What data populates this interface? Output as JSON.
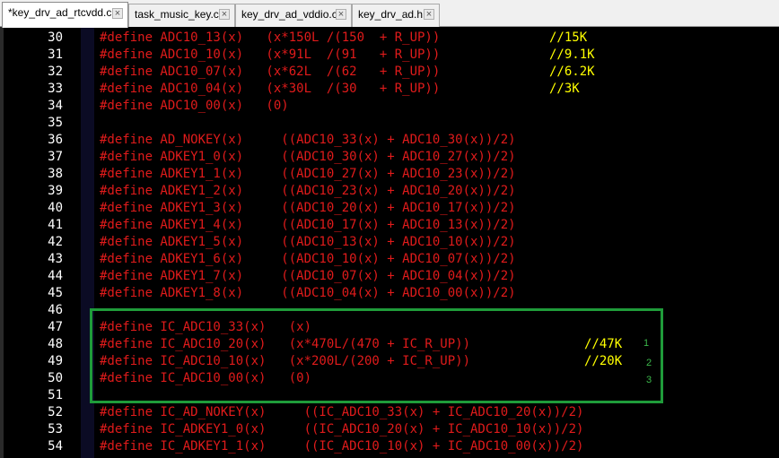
{
  "tabs": [
    {
      "label": "*key_drv_ad_rtcvdd.c",
      "active": true
    },
    {
      "label": "task_music_key.c",
      "active": false
    },
    {
      "label": "key_drv_ad_vddio.c",
      "active": false
    },
    {
      "label": "key_drv_ad.h",
      "active": false
    }
  ],
  "tab_close_glyph": "×",
  "lines": [
    {
      "n": "30",
      "code": "#define ADC10_13(x)   (x*150L /(150  + R_UP))",
      "comment": "//15K"
    },
    {
      "n": "31",
      "code": "#define ADC10_10(x)   (x*91L  /(91   + R_UP))",
      "comment": "//9.1K"
    },
    {
      "n": "32",
      "code": "#define ADC10_07(x)   (x*62L  /(62   + R_UP))",
      "comment": "//6.2K"
    },
    {
      "n": "33",
      "code": "#define ADC10_04(x)   (x*30L  /(30   + R_UP))",
      "comment": "//3K"
    },
    {
      "n": "34",
      "code": "#define ADC10_00(x)   (0)",
      "comment": ""
    },
    {
      "n": "35",
      "code": "",
      "comment": ""
    },
    {
      "n": "36",
      "code": "#define AD_NOKEY(x)     ((ADC10_33(x) + ADC10_30(x))/2)",
      "comment": ""
    },
    {
      "n": "37",
      "code": "#define ADKEY1_0(x)     ((ADC10_30(x) + ADC10_27(x))/2)",
      "comment": ""
    },
    {
      "n": "38",
      "code": "#define ADKEY1_1(x)     ((ADC10_27(x) + ADC10_23(x))/2)",
      "comment": ""
    },
    {
      "n": "39",
      "code": "#define ADKEY1_2(x)     ((ADC10_23(x) + ADC10_20(x))/2)",
      "comment": ""
    },
    {
      "n": "40",
      "code": "#define ADKEY1_3(x)     ((ADC10_20(x) + ADC10_17(x))/2)",
      "comment": ""
    },
    {
      "n": "41",
      "code": "#define ADKEY1_4(x)     ((ADC10_17(x) + ADC10_13(x))/2)",
      "comment": ""
    },
    {
      "n": "42",
      "code": "#define ADKEY1_5(x)     ((ADC10_13(x) + ADC10_10(x))/2)",
      "comment": ""
    },
    {
      "n": "43",
      "code": "#define ADKEY1_6(x)     ((ADC10_10(x) + ADC10_07(x))/2)",
      "comment": ""
    },
    {
      "n": "44",
      "code": "#define ADKEY1_7(x)     ((ADC10_07(x) + ADC10_04(x))/2)",
      "comment": ""
    },
    {
      "n": "45",
      "code": "#define ADKEY1_8(x)     ((ADC10_04(x) + ADC10_00(x))/2)",
      "comment": ""
    },
    {
      "n": "46",
      "code": "",
      "comment": ""
    },
    {
      "n": "47",
      "code": "#define IC_ADC10_33(x)   (x)",
      "comment": ""
    },
    {
      "n": "48",
      "code": "#define IC_ADC10_20(x)   (x*470L/(470 + IC_R_UP))",
      "comment": "//47K"
    },
    {
      "n": "49",
      "code": "#define IC_ADC10_10(x)   (x*200L/(200 + IC_R_UP))",
      "comment": "//20K"
    },
    {
      "n": "50",
      "code": "#define IC_ADC10_00(x)   (0)",
      "comment": ""
    },
    {
      "n": "51",
      "code": "",
      "comment": ""
    },
    {
      "n": "52",
      "code": "#define IC_AD_NOKEY(x)     ((IC_ADC10_33(x) + IC_ADC10_20(x))/2)",
      "comment": ""
    },
    {
      "n": "53",
      "code": "#define IC_ADKEY1_0(x)     ((IC_ADC10_20(x) + IC_ADC10_10(x))/2)",
      "comment": ""
    },
    {
      "n": "54",
      "code": "#define IC_ADKEY1_1(x)     ((IC_ADC10_10(x) + IC_ADC10_00(x))/2)",
      "comment": ""
    }
  ],
  "annotation_numbers": [
    "1",
    "2",
    "3"
  ],
  "colors": {
    "code": "#e01b1b",
    "comment": "#ffff00",
    "line_number": "#ffffff",
    "highlight_box": "#1f9c3a",
    "background": "#000000"
  }
}
